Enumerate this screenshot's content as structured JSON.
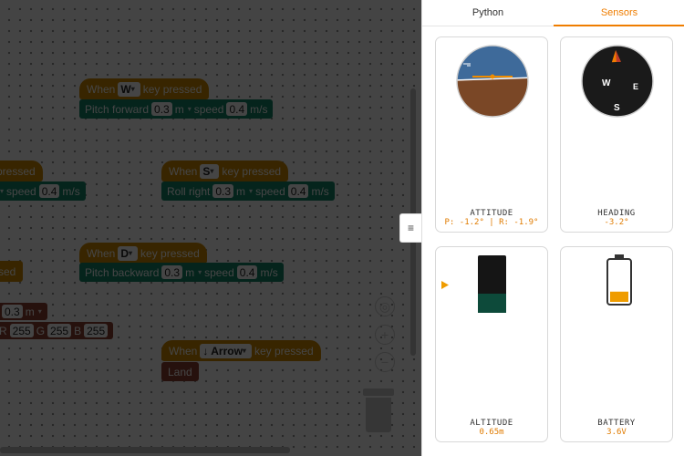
{
  "tabs": {
    "python": "Python",
    "sensors": "Sensors"
  },
  "panel_handle_icon": "≡",
  "workspace": {
    "blocks": {
      "w": {
        "when": "When",
        "key": "W",
        "tail": "key pressed",
        "action": "Pitch forward",
        "dist": "0.3",
        "unit1": "m",
        "speed": "speed",
        "spd": "0.4",
        "unit2": "m/s"
      },
      "s": {
        "when": "When",
        "key": "S",
        "tail": "key pressed",
        "action": "Roll right",
        "dist": "0.3",
        "unit1": "m",
        "speed": "speed",
        "spd": "0.4",
        "unit2": "m/s"
      },
      "a": {
        "tail": "pressed",
        "speed": "speed",
        "spd": "0.4",
        "unit2": "m/s"
      },
      "d": {
        "when": "When",
        "key": "D",
        "tail": "key pressed",
        "action": "Pitch backward",
        "dist": "0.3",
        "unit1": "m",
        "speed": "speed",
        "spd": "0.4",
        "unit2": "m/s"
      },
      "partial": {
        "text": "sed"
      },
      "led": {
        "dist": "0.3",
        "unit1": "m",
        "r": "R",
        "rv": "255",
        "g": "G",
        "gv": "255",
        "b": "B",
        "bv": "255"
      },
      "arrow": {
        "when": "When",
        "key": "↓ Arrow",
        "tail": "key pressed",
        "land": "Land"
      }
    },
    "tools": {
      "center": "◎",
      "zoom_in": "+",
      "zoom_out": "−"
    }
  },
  "sensors": {
    "attitude": {
      "label": "ATTITUDE",
      "value": "P: -1.2° | R: -1.9°",
      "pitch": -1.2,
      "roll": -1.9
    },
    "heading": {
      "label": "HEADING",
      "value": "-3.2°",
      "heading_deg": -3.2,
      "compass": {
        "w": "W",
        "e": "E",
        "s": "S"
      }
    },
    "altitude": {
      "label": "ALTITUDE",
      "value": "0.65m"
    },
    "battery": {
      "label": "BATTERY",
      "value": "3.6V",
      "level": 0.3
    }
  },
  "colors": {
    "accent": "#ef7d00",
    "sky": "#3e6a9a",
    "ground": "#7a4726",
    "event_block": "#d08a00",
    "motion_block": "#14846a",
    "led_block": "#8e4030"
  }
}
